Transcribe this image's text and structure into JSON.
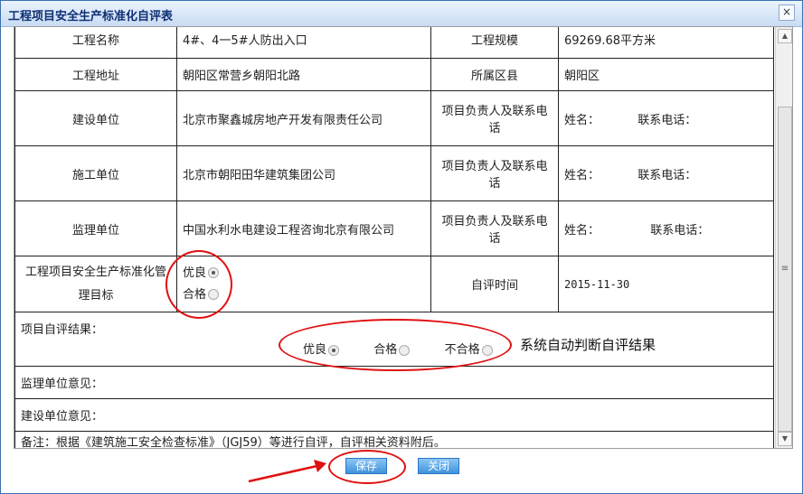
{
  "window": {
    "title": "工程项目安全生产标准化自评表",
    "close_label": "×"
  },
  "rows": {
    "name": {
      "label": "工程名称",
      "value": "4#、4一5#人防出入口",
      "scale_label": "工程规模",
      "scale_value": "69269.68平方米"
    },
    "address": {
      "label": "工程地址",
      "value": "朝阳区常营乡朝阳北路",
      "district_label": "所属区县",
      "district_value": "朝阳区"
    },
    "builder": {
      "label": "建设单位",
      "value": "北京市聚鑫城房地产开发有限责任公司",
      "contact_label": "项目负责人及联系电话",
      "name_label": "姓名：",
      "phone_label": "联系电话："
    },
    "contractor": {
      "label": "施工单位",
      "value": "北京市朝阳田华建筑集团公司",
      "contact_label": "项目负责人及联系电话",
      "name_label": "姓名：",
      "phone_label": "联系电话："
    },
    "supervisor": {
      "label": "监理单位",
      "value": "中国水利水电建设工程咨询北京有限公司",
      "contact_label": "项目负责人及联系电话",
      "name_label": "姓名：",
      "phone_label": "联系电话："
    },
    "goal": {
      "label": "工程项目安全生产标准化管理目标",
      "opt_good": "优良",
      "opt_pass": "合格",
      "eval_time_label": "自评时间",
      "eval_time_value": "2015-11-30"
    },
    "result": {
      "label": "项目自评结果：",
      "opt_good": "优良",
      "opt_pass": "合格",
      "opt_fail": "不合格"
    },
    "supervisor_opinion": {
      "label": "监理单位意见："
    },
    "builder_opinion": {
      "label": "建设单位意见："
    },
    "remark": "备注：根据《建筑施工安全检查标准》（JGJ59）等进行自评，自评相关资料附后。"
  },
  "annotation": {
    "auto_judge": "系统自动判断自评结果"
  },
  "buttons": {
    "save": "保存",
    "close": "关闭"
  },
  "selected": {
    "goal": "优良",
    "result": "优良"
  },
  "colors": {
    "annotation": "#e01010",
    "button": "#3f93dc",
    "title": "#0f2f73"
  }
}
